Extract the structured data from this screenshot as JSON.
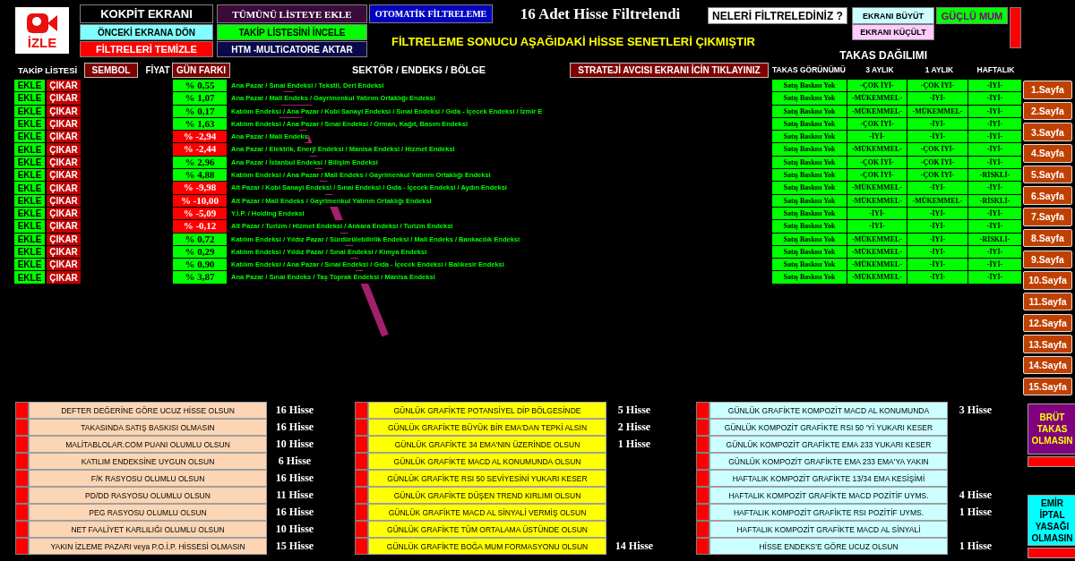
{
  "header": {
    "logo_text": "İZLE",
    "cockpit_button": "KOKPİT EKRANI",
    "back_button": "ÖNCEKİ EKRANA DÖN",
    "clear_filters_button": "FİLTRELERİ TEMİZLE",
    "add_all_button": "TÜMÜNÜ LİSTEYE EKLE",
    "review_list_button": "TAKİP LİSTESİNİ İNCELE",
    "export_button": "HTM -MULTiCATORE AKTAR",
    "auto_filter_button": "OTOMATİK FİLTRELEME",
    "result_title": "16 Adet Hisse Filtrelendi",
    "what_filtered_button": "NELERİ FİLTRELEDİNİZ ?",
    "zoom_in_button": "EKRANI BÜYÜT",
    "zoom_out_button": "EKRANI KÜÇÜLT",
    "strong_candle_button": "GÜÇLÜ MUM",
    "headline": "FİLTRELEME SONUCU AŞAĞIDAKİ HİSSE SENETLERİ ÇIKMIŞTIR",
    "takas_title": "TAKAS DAĞILIMI"
  },
  "columns": {
    "watchlist": "TAKİP LİSTESİ",
    "symbol": "SEMBOL",
    "price": "FİYAT",
    "day_change": "GÜN FARKI",
    "sector": "SEKTÖR / ENDEKS / BÖLGE",
    "strategy_button": "STRATEJİ AVCISI EKRANI İCİN TIKLAYINIZ",
    "takas_view": "TAKAS GÖRÜNÜMÜ",
    "three_month": "3 AYLIK",
    "one_month": "1 AYLIK",
    "weekly": "HAFTALIK"
  },
  "rows": [
    {
      "add": "EKLE",
      "remove": "ÇIKAR",
      "change": "% 0,55",
      "color": "#00ff00",
      "sector": "Ana Pazar / Sınai Endeksi / Tekstil, Deri Endeksi",
      "takas": "Satış Baskısı Yok",
      "three_month": "-ÇOK İYİ-",
      "one_month": "-ÇOK İYİ-",
      "weekly": "-İYİ-"
    },
    {
      "add": "EKLE",
      "remove": "ÇIKAR",
      "change": "% 1,07",
      "color": "#00ff00",
      "sector": "Ana Pazar / Mali Endeks / Gayrimenkul Yatırım Ortaklığı Endeksi",
      "takas": "Satış Baskısı Yok",
      "three_month": "-MÜKEMMEL-",
      "one_month": "-İYİ-",
      "weekly": "-İYİ-"
    },
    {
      "add": "EKLE",
      "remove": "ÇIKAR",
      "change": "% 0,17",
      "color": "#00ff00",
      "sector": "Katılım Endeksi / Ana Pazar / Kobi Sanayi Endeksi / Sınai Endeksi / Gıda - İçecek Endeksi / İzmir E",
      "takas": "Satış Baskısı Yok",
      "three_month": "-MÜKEMMEL-",
      "one_month": "-MÜKEMMEL-",
      "weekly": "-İYİ-"
    },
    {
      "add": "EKLE",
      "remove": "ÇIKAR",
      "change": "% 1,63",
      "color": "#00ff00",
      "sector": "Katılım Endeksi / Ana Pazar / Sınai Endeksi / Orman, Kağıt, Basım Endeksi",
      "takas": "Satış Baskısı Yok",
      "three_month": "-ÇOK İYİ-",
      "one_month": "-İYİ-",
      "weekly": "-İYİ-"
    },
    {
      "add": "EKLE",
      "remove": "ÇIKAR",
      "change": "% -2,94",
      "color": "#ff0000",
      "sector": "Ana Pazar / Mali Endeks",
      "takas": "Satış Baskısı Yok",
      "three_month": "-İYİ-",
      "one_month": "-İYİ-",
      "weekly": "-İYİ-"
    },
    {
      "add": "EKLE",
      "remove": "ÇIKAR",
      "change": "% -2,44",
      "color": "#ff0000",
      "sector": "Ana Pazar / Elektrik, Enerji Endeksi / Manisa Endeksi / Hizmet Endeksi",
      "takas": "Satış Baskısı Yok",
      "three_month": "-MÜKEMMEL-",
      "one_month": "-ÇOK İYİ-",
      "weekly": "-İYİ-"
    },
    {
      "add": "EKLE",
      "remove": "ÇIKAR",
      "change": "% 2,96",
      "color": "#00ff00",
      "sector": "Ana Pazar / İstanbul Endeksi / Bilişim Endeksi",
      "takas": "Satış Baskısı Yok",
      "three_month": "-ÇOK İYİ-",
      "one_month": "-ÇOK İYİ-",
      "weekly": "-İYİ-"
    },
    {
      "add": "EKLE",
      "remove": "ÇIKAR",
      "change": "% 4,88",
      "color": "#00ff00",
      "sector": "Katılım Endeksi / Ana Pazar / Mali Endeks / Gayrimenkul Yatırım Ortaklığı Endeksi",
      "takas": "Satış Baskısı Yok",
      "three_month": "-ÇOK İYİ-",
      "one_month": "-ÇOK İYİ-",
      "weekly": "-RİSKLİ-"
    },
    {
      "add": "EKLE",
      "remove": "ÇIKAR",
      "change": "% -9,98",
      "color": "#ff0000",
      "sector": "Alt Pazar / Kobi Sanayi Endeksi / Sınai Endeksi / Gıda - İçecek Endeksi / Aydın Endeksi",
      "takas": "Satış Baskısı Yok",
      "three_month": "-MÜKEMMEL-",
      "one_month": "-İYİ-",
      "weekly": "-İYİ-"
    },
    {
      "add": "EKLE",
      "remove": "ÇIKAR",
      "change": "% -10,00",
      "color": "#ff0000",
      "sector": "Alt Pazar / Mali Endeks / Gayrimenkul Yatırım Ortaklığı Endeksi",
      "takas": "Satış Baskısı Yok",
      "three_month": "-MÜKEMMEL-",
      "one_month": "-MÜKEMMEL-",
      "weekly": "-RİSKLİ-"
    },
    {
      "add": "EKLE",
      "remove": "ÇIKAR",
      "change": "% -5,09",
      "color": "#ff0000",
      "sector": "Y.İ.P. / Holding Endeksi",
      "takas": "Satış Baskısı Yok",
      "three_month": "-İYİ-",
      "one_month": "-İYİ-",
      "weekly": "-İYİ-"
    },
    {
      "add": "EKLE",
      "remove": "ÇIKAR",
      "change": "% -0,12",
      "color": "#ff0000",
      "sector": "Alt Pazar / Turizm / Hizmet Endeksi / Ankara Endeksi / Turizm Endeksi",
      "takas": "Satış Baskısı Yok",
      "three_month": "-İYİ-",
      "one_month": "-İYİ-",
      "weekly": "-İYİ-"
    },
    {
      "add": "EKLE",
      "remove": "ÇIKAR",
      "change": "% 0,72",
      "color": "#00ff00",
      "sector": "Katılım Endeksi / Yıldız Pazar / Sürdürülebilirlik Endeksi / Mali Endeks / Bankacılık Endeksi",
      "takas": "Satış Baskısı Yok",
      "three_month": "-MÜKEMMEL-",
      "one_month": "-İYİ-",
      "weekly": "-RİSKLİ-"
    },
    {
      "add": "EKLE",
      "remove": "ÇIKAR",
      "change": "% 0,29",
      "color": "#00ff00",
      "sector": "Katılım Endeksi / Yıldız Pazar / Sınai Endeksi / Kimya Endeksi",
      "takas": "Satış Baskısı Yok",
      "three_month": "-MÜKEMMEL-",
      "one_month": "-İYİ-",
      "weekly": "-İYİ-"
    },
    {
      "add": "EKLE",
      "remove": "ÇIKAR",
      "change": "% 0,90",
      "color": "#00ff00",
      "sector": "Katılım Endeksi / Ana Pazar / Sınai Endeksi / Gıda - İçecek Endeksi / Balıkesir Endeksi",
      "takas": "Satış Baskısı Yok",
      "three_month": "-MÜKEMMEL-",
      "one_month": "-İYİ-",
      "weekly": "-İYİ-"
    },
    {
      "add": "EKLE",
      "remove": "ÇIKAR",
      "change": "% 3,87",
      "color": "#00ff00",
      "sector": "Ana Pazar / Sınai Endeks / Taş Toprak Endeksi / Manisa Endeksi",
      "takas": "Satış Baskısı Yok",
      "three_month": "-MÜKEMMEL-",
      "one_month": "-İYİ-",
      "weekly": "-İYİ-"
    }
  ],
  "pages": [
    "1.Sayfa",
    "2.Sayfa",
    "3.Sayfa",
    "4.Sayfa",
    "5.Sayfa",
    "6.Sayfa",
    "7.Sayfa",
    "8.Sayfa",
    "9.Sayfa",
    "10.Sayfa",
    "11.Sayfa",
    "12.Sayfa",
    "13.Sayfa",
    "14.Sayfa",
    "15.Sayfa"
  ],
  "filter_groups": [
    {
      "kind": "fundamental",
      "items": [
        {
          "label": "DEFTER DEĞERİNE GÖRE UCUZ HİSSE OLSUN",
          "count": "16 Hisse",
          "checked": false
        },
        {
          "label": "TAKASINDA SATIŞ BASKISI OLMASIN",
          "count": "16 Hisse",
          "checked": false
        },
        {
          "label": "MALİTABLOLAR.COM PUANI OLUMLU OLSUN",
          "count": "10 Hisse",
          "checked": false
        },
        {
          "label": "KATILIM ENDEKSİNE UYGUN OLSUN",
          "count": "6 Hisse",
          "checked": false
        },
        {
          "label": "F/K RASYOSU OLUMLU OLSUN",
          "count": "16 Hisse",
          "checked": false
        },
        {
          "label": "PD/DD RASYOSU OLUMLU OLSUN",
          "count": "11 Hisse",
          "checked": false
        },
        {
          "label": "PEG RASYOSU OLUMLU OLSUN",
          "count": "16 Hisse",
          "checked": false
        },
        {
          "label": "NET FAALİYET KARLILIĞI OLUMLU OLSUN",
          "count": "10 Hisse",
          "checked": false
        },
        {
          "label": "YAKIN İZLEME PAZARI veya P.O.İ.P. HİSSESİ OLMASIN",
          "count": "15 Hisse",
          "checked": false
        }
      ]
    },
    {
      "kind": "daily",
      "items": [
        {
          "label": "GÜNLÜK GRAFİKTE POTANSİYEL DİP BÖLGESİNDE",
          "count": "5 Hisse",
          "checked": false
        },
        {
          "label": "GÜNLÜK GRAFİKTE BÜYÜK BİR EMA'DAN TEPKİ ALSIN",
          "count": "2 Hisse",
          "checked": false
        },
        {
          "label": "GÜNLÜK GRAFİKTE 34 EMA'NIN ÜZERİNDE OLSUN",
          "count": "1 Hisse",
          "checked": false
        },
        {
          "label": "GÜNLÜK GRAFİKTE MACD AL KONUMUNDA OLSUN",
          "checked": false
        },
        {
          "label": "GÜNLÜK GRAFİKTE RSI 50 SEVİYESİNİ YUKARI KESER",
          "checked": false
        },
        {
          "label": "GÜNLÜK GRAFİKTE DÜŞEN TREND KIRLIMI OLSUN",
          "checked": false
        },
        {
          "label": "GÜNLÜK GRAFİKTE MACD AL SİNYALİ VERMİŞ OLSUN",
          "checked": false
        },
        {
          "label": "GÜNLÜK GRAFİKTE TÜM ORTALAMA ÜSTÜNDE OLSUN",
          "checked": false
        },
        {
          "label": "GÜNLÜK GRAFİKTE BOĞA MUM FORMASYONU OLSUN",
          "count": "14 Hisse",
          "checked": false
        }
      ]
    },
    {
      "kind": "composite",
      "items": [
        {
          "label": "GÜNLÜK GRAFİKTE KOMPOZİT MACD AL KONUMUNDA",
          "count": "3 Hisse",
          "checked": false
        },
        {
          "label": "GÜNLÜK KOMPOZİT GRAFİKTE RSI 50 'Yİ YUKARI KESER",
          "checked": false
        },
        {
          "label": "GÜNLÜK KOMPOZİT GRAFİKTE EMA 233 YUKARI KESER",
          "checked": false
        },
        {
          "label": "GÜNLÜK KOMPOZİT GRAFİKTE EMA 233 EMA'YA YAKIN",
          "checked": false
        },
        {
          "label": "HAFTALIK KOMPOZİT GRAFİKTE 13/34 EMA KESİŞİMİ",
          "checked": false
        },
        {
          "label": "HAFTALIK KOMPOZİT GRAFİKTE MACD POZİTİF UYMS.",
          "count": "4 Hisse",
          "checked": false
        },
        {
          "label": "HAFTALIK KOMPOZİT GRAFİKTE RSI POZİTİF UYMS.",
          "count": "1 Hisse",
          "checked": false
        },
        {
          "label": "HAFTALIK KOMPOZİT GRAFİKTE MACD AL SİNYALİ",
          "checked": false
        },
        {
          "label": "HİSSE ENDEKS'E GÖRE UCUZ OLSUN",
          "count": "1 Hisse",
          "checked": false
        }
      ]
    }
  ],
  "side_flags": [
    {
      "label": "BRÜT TAKAS OLMASIN",
      "kind": "purple"
    },
    {
      "label": "EMİR İPTAL YASAĞI OLMASIN",
      "kind": "cyan"
    }
  ]
}
